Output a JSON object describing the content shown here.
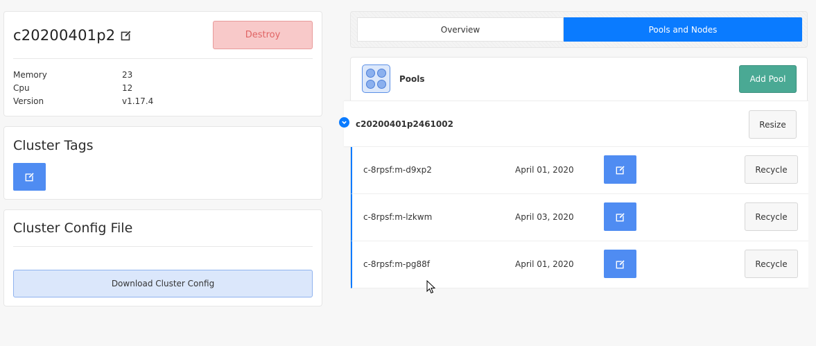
{
  "cluster": {
    "name": "c20200401p2",
    "destroy_label": "Destroy",
    "details": [
      {
        "key": "Memory",
        "value": "23"
      },
      {
        "key": "Cpu",
        "value": "12"
      },
      {
        "key": "Version",
        "value": "v1.17.4"
      }
    ]
  },
  "tags": {
    "title": "Cluster Tags"
  },
  "config": {
    "title": "Cluster Config File",
    "download_label": "Download Cluster Config"
  },
  "tabs": [
    {
      "label": "Overview",
      "active": false
    },
    {
      "label": "Pools and Nodes",
      "active": true
    }
  ],
  "pools": {
    "title": "Pools",
    "add_label": "Add Pool",
    "pool": {
      "name": "c20200401p2461002",
      "resize_label": "Resize",
      "nodes": [
        {
          "name": "c-8rpsf:m-d9xp2",
          "date": "April 01, 2020",
          "recycle_label": "Recycle"
        },
        {
          "name": "c-8rpsf:m-lzkwm",
          "date": "April 03, 2020",
          "recycle_label": "Recycle"
        },
        {
          "name": "c-8rpsf:m-pg88f",
          "date": "April 01, 2020",
          "recycle_label": "Recycle"
        }
      ]
    }
  },
  "colors": {
    "primary": "#0a7bff",
    "icon_button": "#4f8cf2",
    "add_pool": "#4aa994",
    "destroy_bg": "#f8c9c9",
    "destroy_text": "#e06464"
  },
  "icons": {
    "edit": "pencil-square-icon",
    "pools": "pool-grid-icon",
    "collapse": "chevron-down-circle-icon"
  }
}
